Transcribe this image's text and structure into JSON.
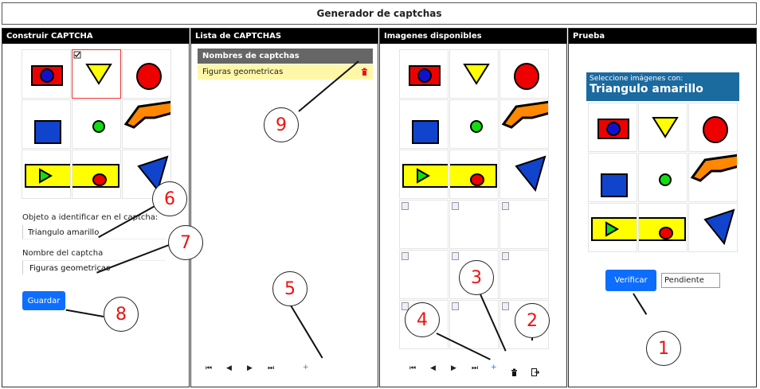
{
  "app_title": "Generador de captchas",
  "panels": {
    "construir": {
      "header": "Construir CAPTCHA",
      "objeto_label": "Objeto a identificar en el captcha:",
      "objeto_value": "Triangulo amarillo",
      "nombre_label": "Nombre del captcha",
      "nombre_value": "Figuras geometricas",
      "guardar_label": "Guardar"
    },
    "lista": {
      "header": "Lista de CAPTCHAS",
      "table_header": "Nombres de captchas",
      "rows": [
        "Figuras geometricas"
      ],
      "nav_first": "⏮",
      "nav_prev": "◀",
      "nav_next": "▶",
      "nav_last": "⏭",
      "add_label": "+"
    },
    "imagenes": {
      "header": "Imagenes disponibles",
      "nav_first": "⏮",
      "nav_prev": "◀",
      "nav_next": "▶",
      "nav_last": "⏭",
      "add_label": "+"
    },
    "prueba": {
      "header": "Prueba",
      "prompt": "Seleccione imágenes con:",
      "target": "Triangulo amarillo",
      "verificar_label": "Verificar",
      "status_value": "Pendiente"
    }
  },
  "callouts": [
    "1",
    "2",
    "3",
    "4",
    "5",
    "6",
    "7",
    "8",
    "9"
  ],
  "colors": {
    "accent_blue": "#0d6efd",
    "row_highlight": "#fff7a8",
    "prompt_bg": "#1b6aa0",
    "delete_red": "#e11"
  }
}
